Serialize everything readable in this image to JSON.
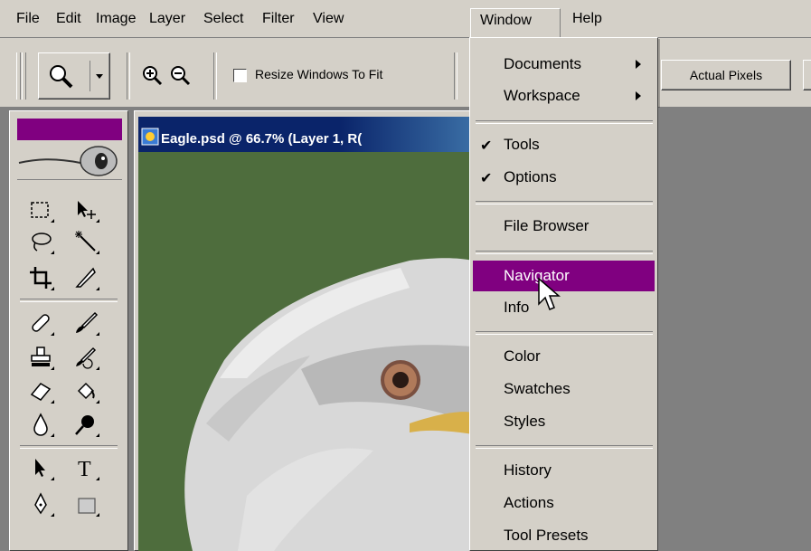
{
  "menubar": {
    "items": [
      "File",
      "Edit",
      "Image",
      "Layer",
      "Select",
      "Filter",
      "View",
      "Window",
      "Help"
    ],
    "active": "Window"
  },
  "options_bar": {
    "resize_checkbox_label": "Resize Windows To Fit",
    "resize_checked": false,
    "actual_pixels_label": "Actual Pixels"
  },
  "document": {
    "title": "Eagle.psd @ 66.7% (Layer 1, R("
  },
  "window_menu": {
    "documents": "Documents",
    "workspace": "Workspace",
    "tools": "Tools",
    "options": "Options",
    "file_browser": "File Browser",
    "navigator": "Navigator",
    "info": "Info",
    "color": "Color",
    "swatches": "Swatches",
    "styles": "Styles",
    "history": "History",
    "actions": "Actions",
    "tool_presets": "Tool Presets",
    "highlighted": "Navigator",
    "checked": [
      "Tools",
      "Options"
    ]
  },
  "tools": [
    "marquee-icon",
    "move-icon",
    "lasso-icon",
    "magic-wand-icon",
    "crop-icon",
    "slice-icon",
    "healing-brush-icon",
    "brush-icon",
    "clone-stamp-icon",
    "history-brush-icon",
    "eraser-icon",
    "paint-bucket-icon",
    "blur-icon",
    "dodge-icon",
    "path-selection-icon",
    "type-icon",
    "pen-icon",
    "shape-icon"
  ],
  "colors": {
    "highlight": "#800080",
    "chrome": "#d4d0c8",
    "canvas_bg": "#4e6d3d"
  }
}
